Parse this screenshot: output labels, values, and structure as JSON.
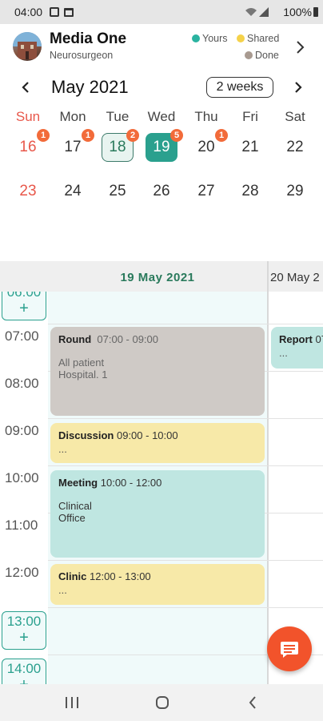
{
  "status_bar": {
    "time": "04:00",
    "battery": "100%"
  },
  "profile": {
    "name": "Media One",
    "title": "Neurosurgeon"
  },
  "legend": [
    {
      "label": "Yours",
      "color": "#2ab3a0"
    },
    {
      "label": "Shared",
      "color": "#f5d24a"
    },
    {
      "label": "Done",
      "color": "#a89a90"
    }
  ],
  "calendar": {
    "month_label": "May 2021",
    "view_mode": "2 weeks",
    "weekdays": [
      "Sun",
      "Mon",
      "Tue",
      "Wed",
      "Thu",
      "Fri",
      "Sat"
    ],
    "week1": [
      "16",
      "17",
      "18",
      "19",
      "20",
      "21",
      "22"
    ],
    "week2": [
      "23",
      "24",
      "25",
      "26",
      "27",
      "28",
      "29"
    ],
    "badges": {
      "16": "1",
      "17": "1",
      "18": "2",
      "19": "5",
      "20": "1"
    },
    "colors": {
      "sunday": "#e8574a",
      "selected": "#2aa08e",
      "today_border": "#3c7a6a",
      "badge": "#f26b3a"
    }
  },
  "day_view": {
    "header_main": "19  May  2021",
    "header_next": "20  May  2",
    "slots": {
      "top_partial": "06:00",
      "s1300": "13:00",
      "s1400": "14:00",
      "plus": "+"
    },
    "hours": [
      "07:00",
      "08:00",
      "09:00",
      "10:00",
      "11:00",
      "12:00"
    ],
    "events": [
      {
        "title": "Round",
        "time": "07:00 - 09:00",
        "line1": "All patient",
        "line2": "Hospital. 1",
        "color": "#cfcac6"
      },
      {
        "title": "Discussion",
        "time": "09:00 - 10:00",
        "line1": "...",
        "color": "#f7e9a8"
      },
      {
        "title": "Meeting",
        "time": "10:00 - 12:00",
        "line1": "Clinical",
        "line2": "Office",
        "color": "#bfe6e1"
      },
      {
        "title": "Clinic",
        "time": "12:00 - 13:00",
        "line1": "...",
        "color": "#f7e9a8"
      }
    ],
    "next_day_event": {
      "title": "Report",
      "time": "07",
      "line1": "...",
      "color": "#bfe6e1"
    }
  }
}
